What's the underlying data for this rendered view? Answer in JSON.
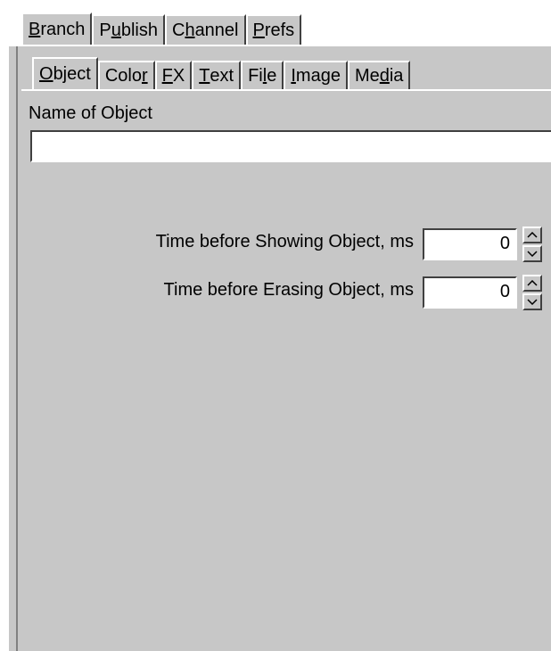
{
  "top_tabs": [
    {
      "pre": "",
      "ul": "B",
      "post": "ranch"
    },
    {
      "pre": "P",
      "ul": "u",
      "post": "blish"
    },
    {
      "pre": "C",
      "ul": "h",
      "post": "annel"
    },
    {
      "pre": "",
      "ul": "P",
      "post": "refs"
    }
  ],
  "sub_tabs": [
    {
      "pre": "",
      "ul": "O",
      "post": "bject"
    },
    {
      "pre": "Colo",
      "ul": "r",
      "post": ""
    },
    {
      "pre": "",
      "ul": "F",
      "post": "X"
    },
    {
      "pre": "",
      "ul": "T",
      "post": "ext"
    },
    {
      "pre": "Fi",
      "ul": "l",
      "post": "e"
    },
    {
      "pre": "",
      "ul": "I",
      "post": "mage"
    },
    {
      "pre": "Me",
      "ul": "d",
      "post": "ia"
    }
  ],
  "object": {
    "name_label": "Name of Object",
    "name_value": "",
    "show_label": "Time before Showing Object, ms",
    "show_value": "0",
    "erase_label": "Time before Erasing Object, ms",
    "erase_value": "0"
  }
}
